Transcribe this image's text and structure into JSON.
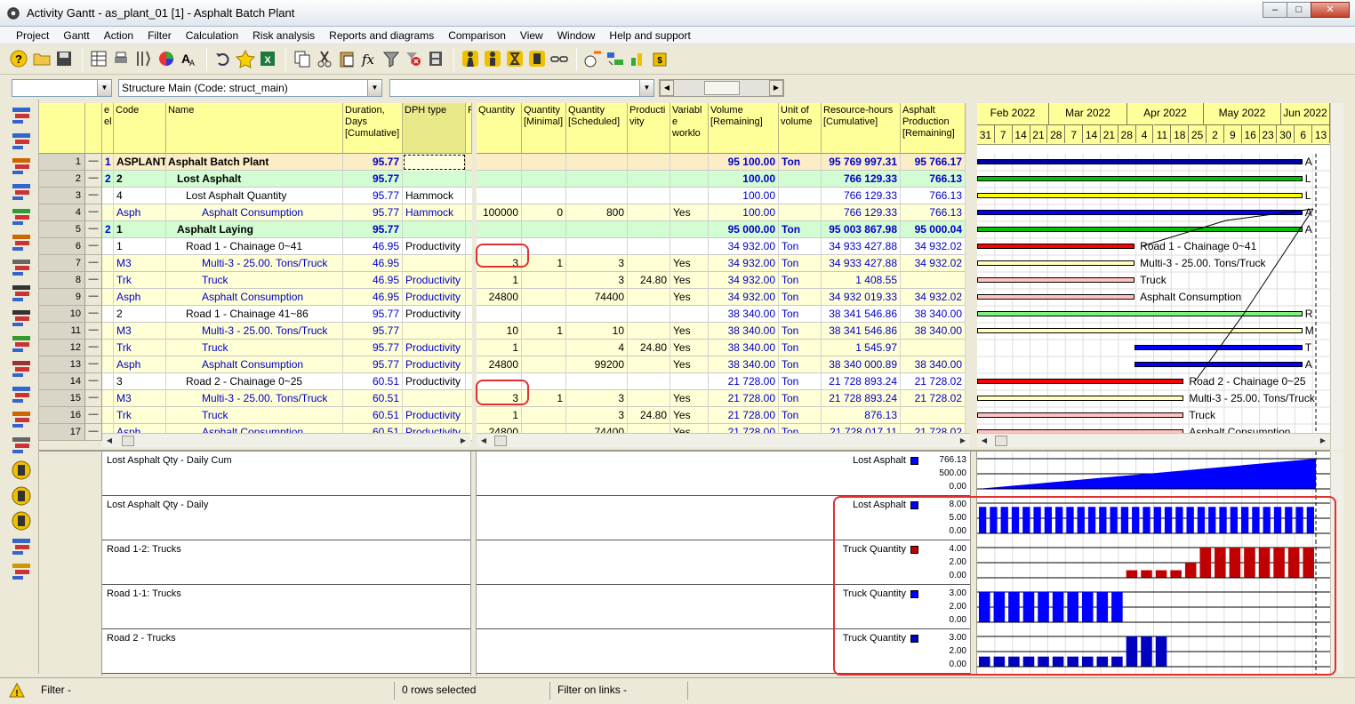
{
  "window": {
    "title": "Activity Gantt - as_plant_01 [1] - Asphalt Batch Plant",
    "btn_min": "–",
    "btn_max": "□",
    "btn_close": "✕"
  },
  "menu": [
    "Project",
    "Gantt",
    "Action",
    "Filter",
    "Calculation",
    "Risk analysis",
    "Reports and diagrams",
    "Comparison",
    "View",
    "Window",
    "Help and support"
  ],
  "combos": {
    "first": "",
    "structure": "Structure Main (Code: struct_main)",
    "third": ""
  },
  "columns": {
    "level": "e\nel",
    "code": "Code",
    "name": "Name",
    "duration": "Duration,\nDays\n[Cumulative]",
    "dph": "DPH type",
    "r": "R",
    "qty": "Quantity",
    "qty_min": "Quantity\n[Minimal]",
    "qty_sched": "Quantity\n[Scheduled]",
    "productivity": "Producti\nvity",
    "variable": "Variabl\ne\nworklo",
    "volume": "Volume\n[Remaining]",
    "unit": "Unit of\nvolume",
    "res_hours": "Resource-hours\n[Cumulative]",
    "asphalt": "Asphalt\nProduction\n[Remaining]"
  },
  "rows": [
    {
      "n": "1",
      "lvl": "1",
      "code": "ASPLANT",
      "name": "Asphalt Batch Plant",
      "dur": "95.77",
      "dph": "",
      "qty": "",
      "qmin": "",
      "qsch": "",
      "prod": "",
      "var": "",
      "vol": "95 100.00",
      "unit": "Ton",
      "rh": "95 769 997.31",
      "asp": "95 766.17"
    },
    {
      "n": "2",
      "lvl": "2",
      "code": "2",
      "name": "Lost Asphalt",
      "dur": "95.77",
      "dph": "",
      "qty": "",
      "qmin": "",
      "qsch": "",
      "prod": "",
      "var": "",
      "vol": "100.00",
      "unit": "",
      "rh": "766 129.33",
      "asp": "766.13"
    },
    {
      "n": "3",
      "lvl": "",
      "code": "4",
      "name": "Lost Asphalt Quantity",
      "dur": "95.77",
      "dph": "Hammock",
      "qty": "",
      "qmin": "",
      "qsch": "",
      "prod": "",
      "var": "",
      "vol": "100.00",
      "unit": "",
      "rh": "766 129.33",
      "asp": "766.13"
    },
    {
      "n": "4",
      "lvl": "",
      "code": "Asph",
      "name": "Asphalt Consumption",
      "dur": "95.77",
      "dph": "Hammock",
      "qty": "100000",
      "qmin": "0",
      "qsch": "800",
      "prod": "",
      "var": "Yes",
      "vol": "100.00",
      "unit": "",
      "rh": "766 129.33",
      "asp": "766.13"
    },
    {
      "n": "5",
      "lvl": "2",
      "code": "1",
      "name": "Asphalt Laying",
      "dur": "95.77",
      "dph": "",
      "qty": "",
      "qmin": "",
      "qsch": "",
      "prod": "",
      "var": "",
      "vol": "95 000.00",
      "unit": "Ton",
      "rh": "95 003 867.98",
      "asp": "95 000.04"
    },
    {
      "n": "6",
      "lvl": "",
      "code": "1",
      "name": "Road 1 - Chainage 0~41",
      "dur": "46.95",
      "dph": "Productivity",
      "qty": "",
      "qmin": "",
      "qsch": "",
      "prod": "",
      "var": "",
      "vol": "34 932.00",
      "unit": "Ton",
      "rh": "34 933 427.88",
      "asp": "34 932.02"
    },
    {
      "n": "7",
      "lvl": "",
      "code": "M3",
      "name": "Multi-3 - 25.00. Tons/Truck",
      "dur": "46.95",
      "dph": "",
      "qty": "3",
      "qmin": "1",
      "qsch": "3",
      "prod": "",
      "var": "Yes",
      "vol": "34 932.00",
      "unit": "Ton",
      "rh": "34 933 427.88",
      "asp": "34 932.02"
    },
    {
      "n": "8",
      "lvl": "",
      "code": "Trk",
      "name": "Truck",
      "dur": "46.95",
      "dph": "Productivity",
      "qty": "1",
      "qmin": "",
      "qsch": "3",
      "prod": "24.80",
      "var": "Yes",
      "vol": "34 932.00",
      "unit": "Ton",
      "rh": "1 408.55",
      "asp": ""
    },
    {
      "n": "9",
      "lvl": "",
      "code": "Asph",
      "name": "Asphalt Consumption",
      "dur": "46.95",
      "dph": "Productivity",
      "qty": "24800",
      "qmin": "",
      "qsch": "74400",
      "prod": "",
      "var": "Yes",
      "vol": "34 932.00",
      "unit": "Ton",
      "rh": "34 932 019.33",
      "asp": "34 932.02"
    },
    {
      "n": "10",
      "lvl": "",
      "code": "2",
      "name": "Road 1 - Chainage 41~86",
      "dur": "95.77",
      "dph": "Productivity",
      "qty": "",
      "qmin": "",
      "qsch": "",
      "prod": "",
      "var": "",
      "vol": "38 340.00",
      "unit": "Ton",
      "rh": "38 341 546.86",
      "asp": "38 340.00"
    },
    {
      "n": "11",
      "lvl": "",
      "code": "M3",
      "name": "Multi-3 - 25.00. Tons/Truck",
      "dur": "95.77",
      "dph": "",
      "qty": "10",
      "qmin": "1",
      "qsch": "10",
      "prod": "",
      "var": "Yes",
      "vol": "38 340.00",
      "unit": "Ton",
      "rh": "38 341 546.86",
      "asp": "38 340.00"
    },
    {
      "n": "12",
      "lvl": "",
      "code": "Trk",
      "name": "Truck",
      "dur": "95.77",
      "dph": "Productivity",
      "qty": "1",
      "qmin": "",
      "qsch": "4",
      "prod": "24.80",
      "var": "Yes",
      "vol": "38 340.00",
      "unit": "Ton",
      "rh": "1 545.97",
      "asp": ""
    },
    {
      "n": "13",
      "lvl": "",
      "code": "Asph",
      "name": "Asphalt Consumption",
      "dur": "95.77",
      "dph": "Productivity",
      "qty": "24800",
      "qmin": "",
      "qsch": "99200",
      "prod": "",
      "var": "Yes",
      "vol": "38 340.00",
      "unit": "Ton",
      "rh": "38 340 000.89",
      "asp": "38 340.00"
    },
    {
      "n": "14",
      "lvl": "",
      "code": "3",
      "name": "Road 2 - Chainage 0~25",
      "dur": "60.51",
      "dph": "Productivity",
      "qty": "",
      "qmin": "",
      "qsch": "",
      "prod": "",
      "var": "",
      "vol": "21 728.00",
      "unit": "Ton",
      "rh": "21 728 893.24",
      "asp": "21 728.02"
    },
    {
      "n": "15",
      "lvl": "",
      "code": "M3",
      "name": "Multi-3 - 25.00. Tons/Truck",
      "dur": "60.51",
      "dph": "",
      "qty": "3",
      "qmin": "1",
      "qsch": "3",
      "prod": "",
      "var": "Yes",
      "vol": "21 728.00",
      "unit": "Ton",
      "rh": "21 728 893.24",
      "asp": "21 728.02"
    },
    {
      "n": "16",
      "lvl": "",
      "code": "Trk",
      "name": "Truck",
      "dur": "60.51",
      "dph": "Productivity",
      "qty": "1",
      "qmin": "",
      "qsch": "3",
      "prod": "24.80",
      "var": "Yes",
      "vol": "21 728.00",
      "unit": "Ton",
      "rh": "876.13",
      "asp": ""
    },
    {
      "n": "17",
      "lvl": "",
      "code": "Asph",
      "name": "Asphalt Consumption",
      "dur": "60.51",
      "dph": "Productivity",
      "qty": "24800",
      "qmin": "",
      "qsch": "74400",
      "prod": "",
      "var": "Yes",
      "vol": "21 728.00",
      "unit": "Ton",
      "rh": "21 728 017.11",
      "asp": "21 728.02"
    }
  ],
  "gantt": {
    "months": [
      "Feb 2022",
      "Mar 2022",
      "Apr 2022",
      "May 2022",
      "Jun 2022"
    ],
    "days": [
      "31",
      "7",
      "14",
      "21",
      "28",
      "7",
      "14",
      "21",
      "28",
      "4",
      "11",
      "18",
      "25",
      "2",
      "9",
      "16",
      "23",
      "30",
      "6",
      "13"
    ],
    "bar_labels": {
      "r1": "A",
      "r2": "L",
      "r3": "L",
      "r4": "A",
      "r5": "A",
      "r6": "Road 1 - Chainage 0~41",
      "r7": "Multi-3 - 25.00. Tons/Truck",
      "r8": "Truck",
      "r9": "Asphalt Consumption",
      "r10": "R",
      "r11": "M",
      "r12": "T",
      "r13": "A",
      "r14": "Road 2 - Chainage 0~25",
      "r15": "Multi-3 - 25.00. Tons/Truck",
      "r16": "Truck",
      "r17": "Asphalt Consumption"
    }
  },
  "histograms": [
    {
      "label": "Lost Asphalt Qty - Daily Cum",
      "legend": "Lost Asphalt",
      "legend_color": "#0000ff",
      "axis": [
        "766.13",
        "500.00",
        "0.00"
      ]
    },
    {
      "label": "Lost Asphalt Qty - Daily",
      "legend": "Lost Asphalt",
      "legend_color": "#0000ff",
      "axis": [
        "8.00",
        "5.00",
        "0.00"
      ]
    },
    {
      "label": "Road 1-2: Trucks",
      "legend": "Truck Quantity",
      "legend_color": "#c00000",
      "axis": [
        "4.00",
        "2.00",
        "0.00"
      ]
    },
    {
      "label": "Road 1-1: Trucks",
      "legend": "Truck Quantity",
      "legend_color": "#0000ff",
      "axis": [
        "3.00",
        "2.00",
        "0.00"
      ]
    },
    {
      "label": "Road 2 - Trucks",
      "legend": "Truck Quantity",
      "legend_color": "#0000c0",
      "axis": [
        "3.00",
        "2.00",
        "0.00"
      ]
    }
  ],
  "status": {
    "filter": "Filter -",
    "selected": "0 rows selected",
    "filter_links": "Filter on links -"
  }
}
